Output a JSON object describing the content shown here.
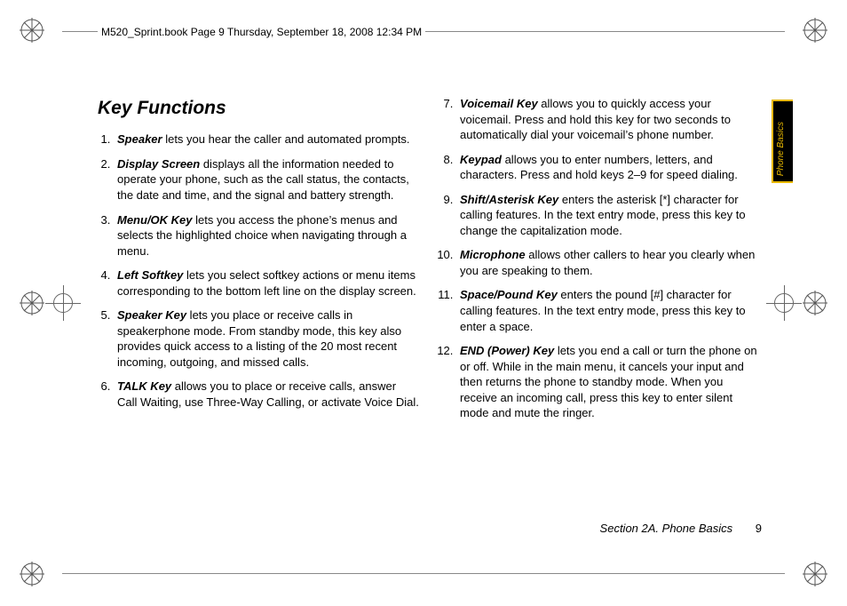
{
  "header": "M520_Sprint.book  Page 9  Thursday, September 18, 2008  12:34 PM",
  "tab": "Phone Basics",
  "title": "Key Functions",
  "items": [
    {
      "term": "Speaker",
      "desc": " lets you hear the caller and automated prompts."
    },
    {
      "term": "Display Screen",
      "desc": " displays all the information needed to operate your phone, such as the call status, the contacts, the date and time, and the signal and battery strength."
    },
    {
      "term": "Menu/OK Key",
      "desc": " lets you access the phone’s menus and selects the highlighted choice when navigating through a menu."
    },
    {
      "term": "Left Softkey",
      "desc": " lets you select softkey actions or menu items corresponding to the bottom left line on the display screen."
    },
    {
      "term": "Speaker Key",
      "desc": " lets you place or receive calls in speakerphone mode. From standby mode, this key also provides quick access to a listing of the 20 most recent incoming, outgoing, and missed calls."
    },
    {
      "term": "TALK Key",
      "desc": " allows you to place or receive calls, answer Call Waiting, use Three-Way Calling, or activate Voice Dial."
    },
    {
      "term": "Voicemail Key",
      "desc": " allows you to quickly access your voicemail. Press and hold this key for two seconds to automatically dial your voicemail’s phone number."
    },
    {
      "term": "Keypad",
      "desc": " allows you to enter numbers, letters, and characters. Press and hold keys 2–9 for speed dialing."
    },
    {
      "term": "Shift/Asterisk Key",
      "desc": " enters the asterisk [*] character for calling features. In the text entry mode, press this key to change the capitalization mode."
    },
    {
      "term": "Microphone",
      "desc": " allows other callers to hear you clearly when you are speaking to them."
    },
    {
      "term": "Space/Pound Key",
      "desc": " enters the pound [#] character for calling features. In the text entry mode, press this key to enter a space."
    },
    {
      "term": "END (Power) Key",
      "desc": " lets you end a call or turn the phone on or off. While in the main menu, it cancels your input and then returns the phone to standby mode. When you receive an incoming call, press this key to enter silent mode and mute the ringer."
    }
  ],
  "footer": {
    "section": "Section 2A. Phone Basics",
    "page": "9"
  }
}
